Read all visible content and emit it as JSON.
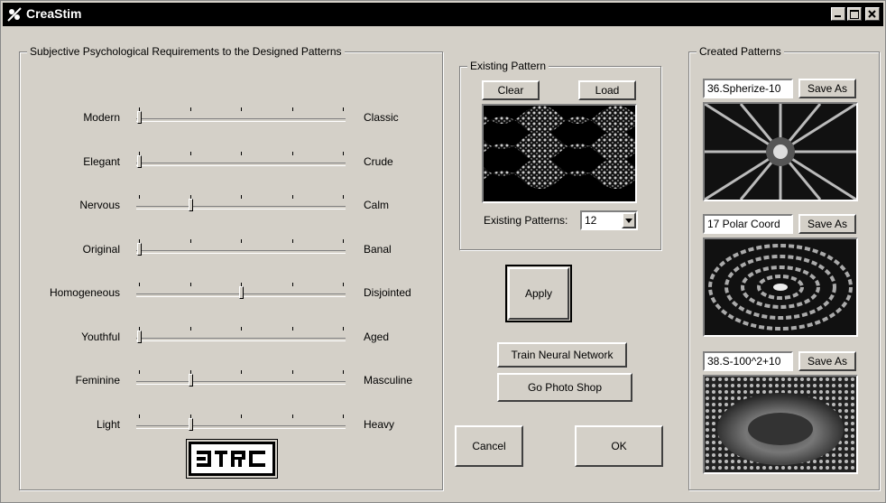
{
  "window": {
    "title": "CreaStim"
  },
  "requirements": {
    "title": "Subjective Psychological Requirements to the Designed Patterns",
    "scales": [
      {
        "left": "Modern",
        "right": "Classic",
        "value": 0
      },
      {
        "left": "Elegant",
        "right": "Crude",
        "value": 0
      },
      {
        "left": "Nervous",
        "right": "Calm",
        "value": 0.25
      },
      {
        "left": "Original",
        "right": "Banal",
        "value": 0
      },
      {
        "left": "Homogeneous",
        "right": "Disjointed",
        "value": 0.5
      },
      {
        "left": "Youthful",
        "right": "Aged",
        "value": 0
      },
      {
        "left": "Feminine",
        "right": "Masculine",
        "value": 0.25
      },
      {
        "left": "Light",
        "right": "Heavy",
        "value": 0.25
      }
    ],
    "logo_text": "DTRC"
  },
  "existing": {
    "title": "Existing Pattern",
    "clear_label": "Clear",
    "load_label": "Load",
    "count_label": "Existing Patterns:",
    "count_value": "12"
  },
  "actions": {
    "apply": "Apply",
    "train": "Train Neural Network",
    "photoshop": "Go Photo Shop",
    "cancel": "Cancel",
    "ok": "OK"
  },
  "created": {
    "title": "Created Patterns",
    "save_label": "Save As",
    "patterns": [
      {
        "name": "36.Spherize-10"
      },
      {
        "name": "17 Polar Coord"
      },
      {
        "name": "38.S-100^2+10"
      }
    ]
  },
  "colors": {
    "face": "#d4d0c8",
    "titlebar": "#000000"
  }
}
